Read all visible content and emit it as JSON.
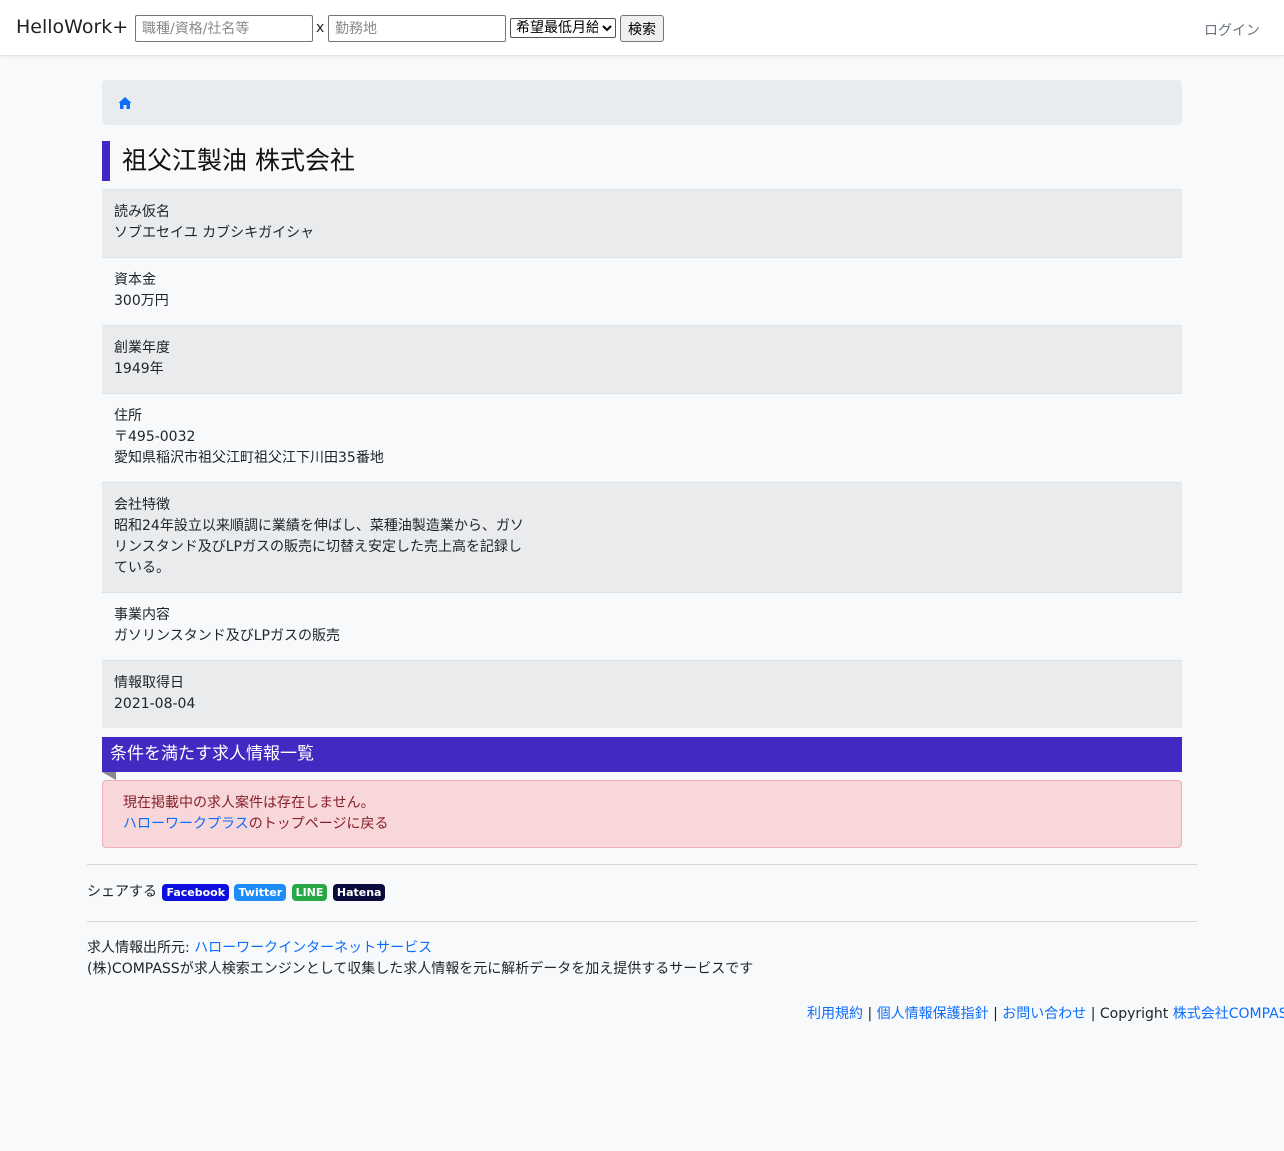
{
  "header": {
    "brand": "HelloWork+",
    "keyword_placeholder": "職種/資格/社名等",
    "times": "x",
    "location_placeholder": "勤務地",
    "salary_selected": "希望最低月給",
    "search_label": "検索",
    "login_label": "ログイン"
  },
  "breadcrumb": {
    "home_icon": "home-icon"
  },
  "company": {
    "name": "祖父江製油 株式会社",
    "fields": [
      {
        "label": "読み仮名",
        "value": "ソブエセイユ カブシキガイシャ"
      },
      {
        "label": "資本金",
        "value": "300万円"
      },
      {
        "label": "創業年度",
        "value": "1949年"
      },
      {
        "label": "住所",
        "value": "〒495-0032\n愛知県稲沢市祖父江町祖父江下川田35番地"
      },
      {
        "label": "会社特徴",
        "value": "昭和24年設立以来順調に業績を伸ばし、菜種油製造業から、ガソリンスタンド及びLPガスの販売に切替え安定した売上高を記録している。"
      },
      {
        "label": "事業内容",
        "value": "ガソリンスタンド及びLPガスの販売"
      },
      {
        "label": "情報取得日",
        "value": "2021-08-04"
      }
    ]
  },
  "jobs": {
    "header": "条件を満たす求人情報一覧",
    "empty_message": "現在掲載中の求人案件は存在しません。",
    "top_link": "ハローワークプラス",
    "top_suffix": "のトップページに戻る"
  },
  "share": {
    "label": "シェアする",
    "facebook": "Facebook",
    "twitter": "Twitter",
    "line": "LINE",
    "hatena": "Hatena",
    "colors": {
      "facebook": "#0d0fdf",
      "twitter": "#1d8cf8",
      "line": "#28a745",
      "hatena": "#0a0a3c"
    }
  },
  "source": {
    "prefix": "求人情報出所元: ",
    "link": "ハローワークインターネットサービス",
    "description": "(株)COMPASSが求人検索エンジンとして収集した求人情報を元に解析データを加え提供するサービスです"
  },
  "footer": {
    "terms": "利用規約",
    "privacy": "個人情報保護指針",
    "contact": "お問い合わせ",
    "sep": " | ",
    "copyright": "Copyright ",
    "company_link": "株式会社COMPASS"
  },
  "colors": {
    "accent": "#3f28c4",
    "link": "#0d6efd"
  }
}
